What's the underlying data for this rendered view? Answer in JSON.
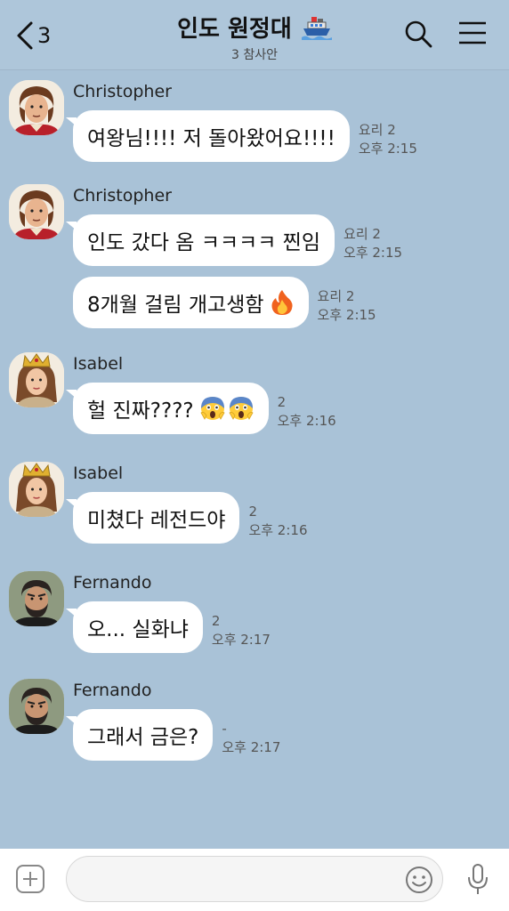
{
  "header": {
    "back_count": "3",
    "title": "인도 원정대",
    "title_icon": "ship-icon",
    "subtitle": "3 참사안"
  },
  "messages": [
    {
      "sender": "Christopher",
      "avatar": "christopher-avatar",
      "bubbles": [
        {
          "text": "여왕님!!!! 저 돌아왔어요!!!!",
          "unread": "요리 2",
          "time": "오후 2:15"
        }
      ]
    },
    {
      "sender": "Christopher",
      "avatar": "christopher-avatar",
      "bubbles": [
        {
          "text": "인도 갔다 옴 ㅋㅋㅋㅋ 찐임",
          "unread": "요리 2",
          "time": "오후 2:15"
        },
        {
          "text": "8개월 걸림 개고생함",
          "emoji": "fire",
          "unread": "요리 2",
          "time": "오후 2:15"
        }
      ]
    },
    {
      "sender": "Isabel",
      "avatar": "isabel-avatar",
      "bubbles": [
        {
          "text": "헐 진짜????",
          "emoji": "screaming-face x2",
          "unread": "2",
          "time": "오후 2:16"
        }
      ]
    },
    {
      "sender": "Isabel",
      "avatar": "isabel-avatar",
      "bubbles": [
        {
          "text": "미쳤다 레전드야",
          "unread": "2",
          "time": "오후 2:16"
        }
      ]
    },
    {
      "sender": "Fernando",
      "avatar": "fernando-avatar",
      "bubbles": [
        {
          "text": "오... 실화냐",
          "unread": "2",
          "time": "오후 2:17"
        }
      ]
    },
    {
      "sender": "Fernando",
      "avatar": "fernando-avatar",
      "bubbles": [
        {
          "text": "그래서 금은?",
          "unread": "-",
          "time": "오후 2:17"
        }
      ]
    }
  ],
  "input": {
    "placeholder": ""
  },
  "colors": {
    "background": "#a9c2d7",
    "bubble": "#ffffff",
    "header": "#aec6da"
  }
}
